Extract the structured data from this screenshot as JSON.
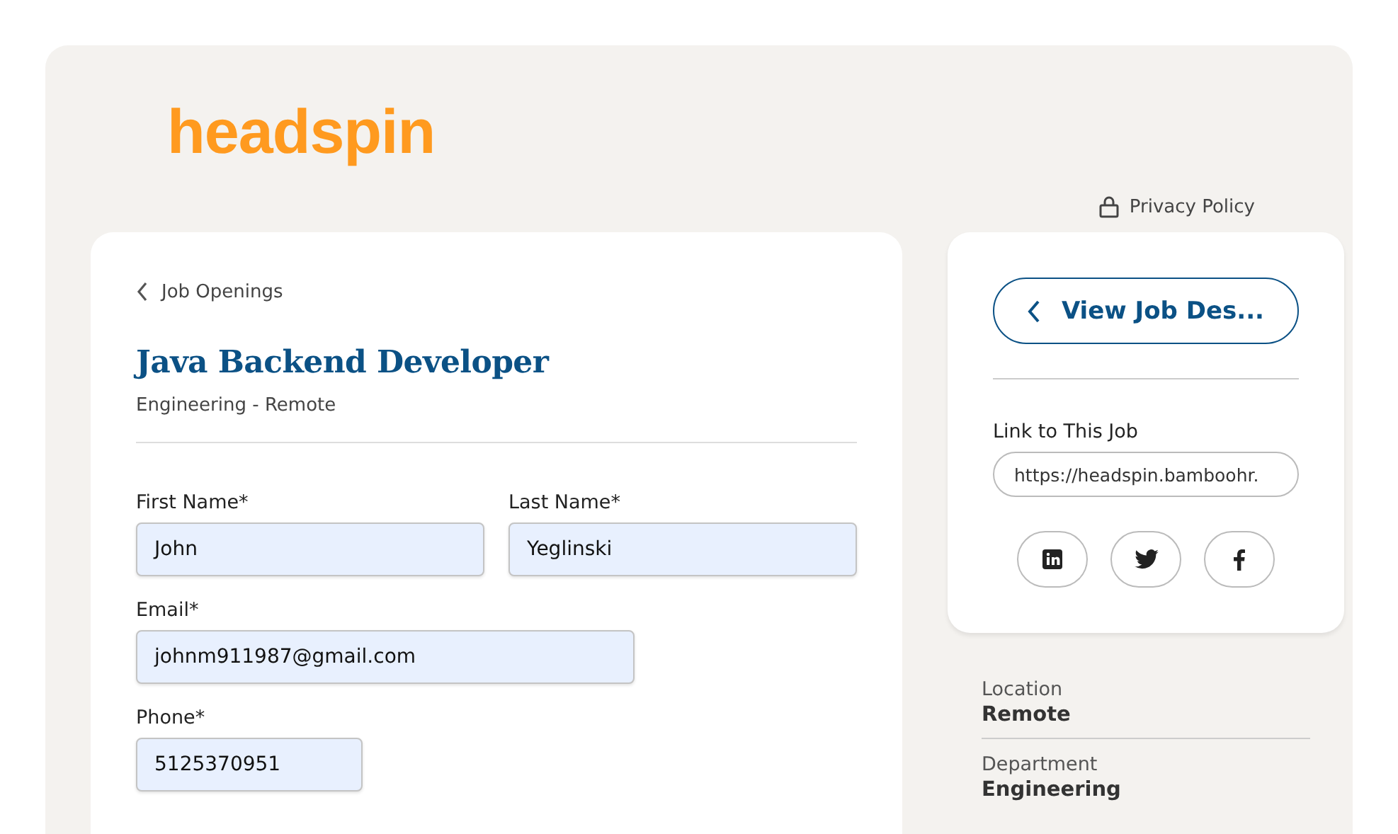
{
  "logo": {
    "text": "headspin"
  },
  "privacy_link": {
    "label": "Privacy Policy"
  },
  "job": {
    "back_link": "Job Openings",
    "title": "Java Backend Developer",
    "subtitle": "Engineering - Remote"
  },
  "form": {
    "fields": [
      {
        "kind": "name",
        "label": "First Name*",
        "value": "John"
      },
      {
        "kind": "name",
        "label": "Last Name*",
        "value": "Yeglinski"
      },
      {
        "kind": "email",
        "label": "Email*",
        "value": "johnm911987@gmail.com"
      },
      {
        "kind": "phone",
        "label": "Phone*",
        "value": "5125370951"
      }
    ]
  },
  "sidebar": {
    "view_button": "View Job Des...",
    "link_label": "Link to This Job",
    "link_value": "https://headspin.bamboohr.",
    "share_buttons": [
      {
        "kind": "linkedin"
      },
      {
        "kind": "twitter"
      },
      {
        "kind": "facebook"
      }
    ],
    "details": [
      {
        "label": "Location",
        "value": "Remote"
      },
      {
        "label": "Department",
        "value": "Engineering"
      }
    ]
  }
}
